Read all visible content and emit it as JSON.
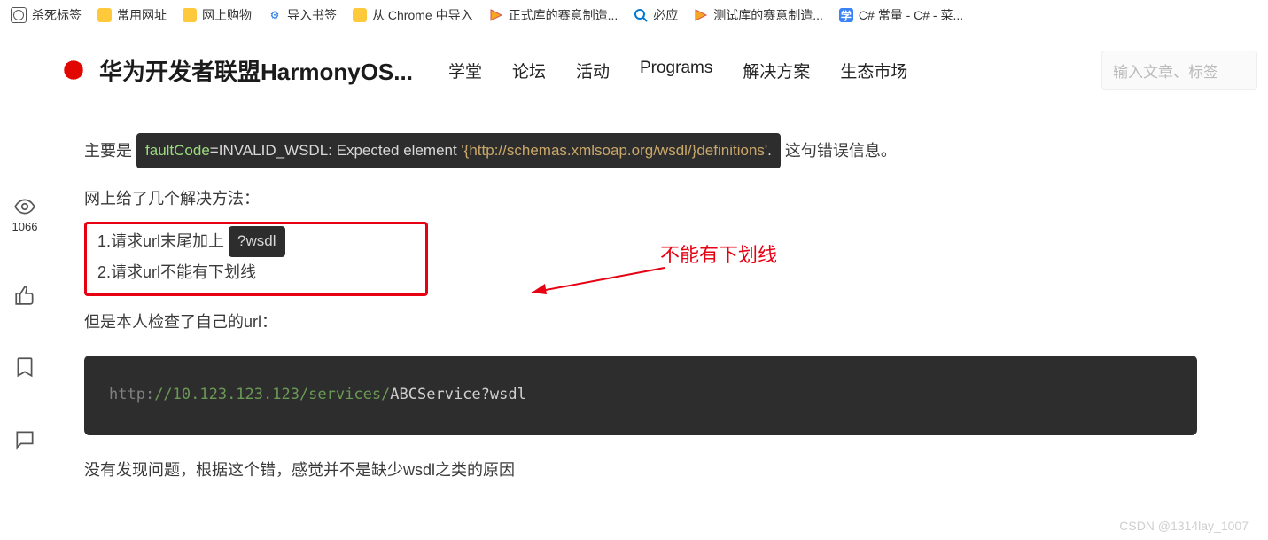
{
  "bookmarks": [
    {
      "icon": "globe",
      "label": "杀死标签"
    },
    {
      "icon": "folder",
      "label": "常用网址"
    },
    {
      "icon": "folder",
      "label": "网上购物"
    },
    {
      "icon": "gear",
      "label": "导入书签"
    },
    {
      "icon": "folder",
      "label": "从 Chrome 中导入"
    },
    {
      "icon": "sw",
      "label": "正式库的赛意制造..."
    },
    {
      "icon": "bing",
      "label": "必应"
    },
    {
      "icon": "sw",
      "label": "测试库的赛意制造..."
    },
    {
      "icon": "xue",
      "label": "C# 常量 - C# - 菜..."
    }
  ],
  "header": {
    "title": "华为开发者联盟HarmonyOS...",
    "nav": [
      "学堂",
      "论坛",
      "活动",
      "Programs",
      "解决方案",
      "生态市场"
    ],
    "search_placeholder": "输入文章、标签"
  },
  "rail": {
    "views": "1066"
  },
  "article": {
    "p1_prefix": "主要是",
    "p1_code_kw": "faultCode",
    "p1_code_mid": "=INVALID_WSDL: Expected element ",
    "p1_code_str": "'{http://schemas.xmlsoap.org/wsdl/}definitions'",
    "p1_code_end": ".",
    "p1_suffix": "这句错误信息。",
    "p2": "网上给了几个解决方法：",
    "sol1_prefix": "1.请求url末尾加上",
    "sol1_pill": "?wsdl",
    "sol2": "2.请求url不能有下划线",
    "annotation": "不能有下划线",
    "p3": "但是本人检查了自己的url：",
    "code_url": {
      "a": "http:",
      "b": "//10.123.123.123/services/",
      "c": "ABCService?wsdl"
    },
    "p4": "没有发现问题，根据这个错，感觉并不是缺少wsdl之类的原因"
  },
  "watermark": "CSDN @1314lay_1007"
}
